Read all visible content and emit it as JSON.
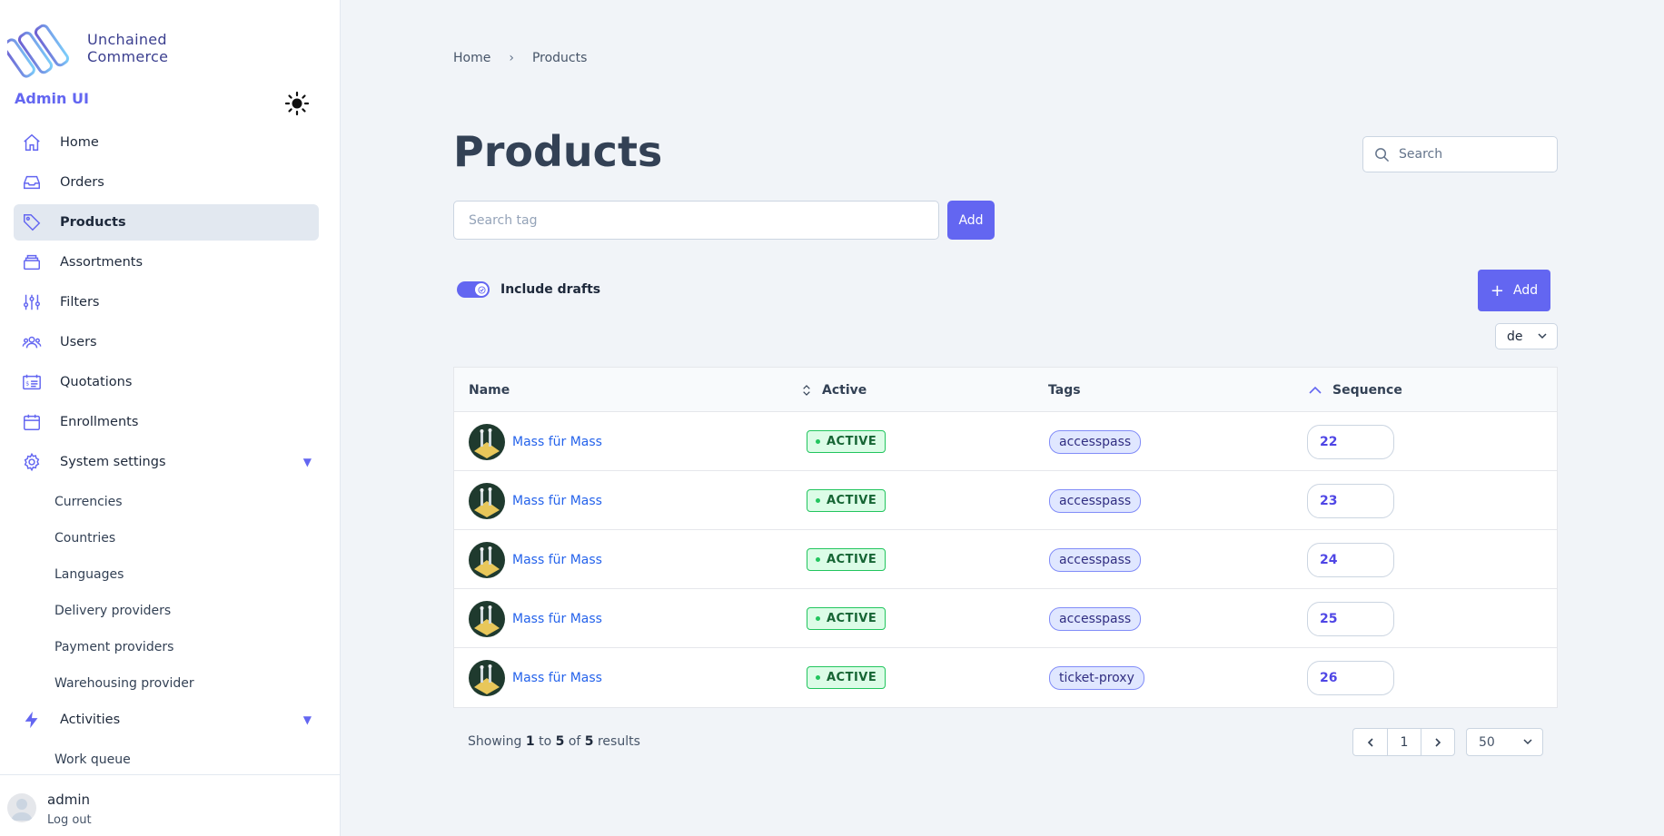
{
  "brand": {
    "name_line1": "Unchained",
    "name_line2": "Commerce",
    "admin_label": "Admin UI"
  },
  "colors": {
    "accent": "#6366f1",
    "link": "#2563eb",
    "active_green": "#22c55e"
  },
  "sidebar": {
    "items": [
      {
        "label": "Home",
        "icon": "home-icon"
      },
      {
        "label": "Orders",
        "icon": "inbox-icon"
      },
      {
        "label": "Products",
        "icon": "tag-icon",
        "active": true
      },
      {
        "label": "Assortments",
        "icon": "stack-icon"
      },
      {
        "label": "Filters",
        "icon": "sliders-icon"
      },
      {
        "label": "Users",
        "icon": "users-icon"
      },
      {
        "label": "Quotations",
        "icon": "quotation-icon"
      },
      {
        "label": "Enrollments",
        "icon": "calendar-icon"
      },
      {
        "label": "System settings",
        "icon": "gear-icon"
      }
    ],
    "system_sub": [
      "Currencies",
      "Countries",
      "Languages",
      "Delivery providers",
      "Payment providers",
      "Warehousing provider"
    ],
    "activities": {
      "label": "Activities",
      "icon": "bolt-icon"
    },
    "activities_sub": [
      "Work queue"
    ]
  },
  "user": {
    "name": "admin",
    "logout": "Log out"
  },
  "breadcrumb": {
    "home": "Home",
    "current": "Products"
  },
  "page": {
    "title": "Products"
  },
  "search": {
    "placeholder": "Search"
  },
  "tag_filter": {
    "placeholder": "Search tag",
    "add_label": "Add"
  },
  "drafts": {
    "label": "Include drafts",
    "on": true
  },
  "toolbar": {
    "add_label": "Add",
    "locale": "de"
  },
  "table": {
    "headers": {
      "name": "Name",
      "active": "Active",
      "tags": "Tags",
      "sequence": "Sequence"
    },
    "rows": [
      {
        "name": "Mass für Mass",
        "status": "ACTIVE",
        "tag": "accesspass",
        "sequence": "22"
      },
      {
        "name": "Mass für Mass",
        "status": "ACTIVE",
        "tag": "accesspass",
        "sequence": "23"
      },
      {
        "name": "Mass für Mass",
        "status": "ACTIVE",
        "tag": "accesspass",
        "sequence": "24"
      },
      {
        "name": "Mass für Mass",
        "status": "ACTIVE",
        "tag": "accesspass",
        "sequence": "25"
      },
      {
        "name": "Mass für Mass",
        "status": "ACTIVE",
        "tag": "ticket-proxy",
        "sequence": "26"
      }
    ]
  },
  "pagination": {
    "showing": "Showing",
    "from": "1",
    "to_word": "to",
    "to": "5",
    "of_word": "of",
    "total": "5",
    "results_word": "results",
    "page": "1",
    "per_page": "50"
  }
}
